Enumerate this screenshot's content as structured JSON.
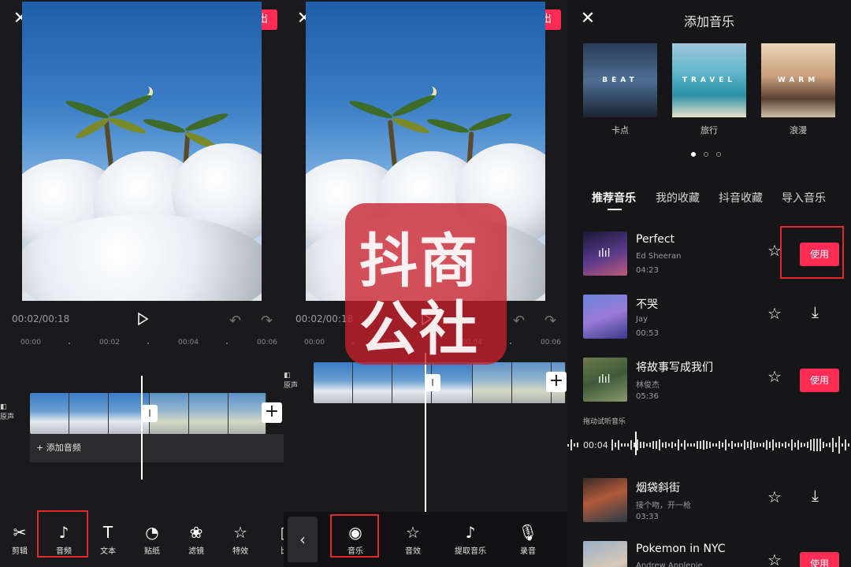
{
  "editor": {
    "export_label": "导出",
    "timecode": "00:02/00:18",
    "ruler_ticks": [
      "00:00",
      "00:02",
      "00:04",
      "00:06"
    ],
    "mute_label": "原声",
    "add_audio_label": "+ 添加音频"
  },
  "toolbar_main": [
    {
      "label": "剪辑",
      "icon": "scissors-icon",
      "glyph": "✂"
    },
    {
      "label": "音频",
      "icon": "music-note-icon",
      "glyph": "♪"
    },
    {
      "label": "文本",
      "icon": "text-icon",
      "glyph": "T"
    },
    {
      "label": "贴纸",
      "icon": "sticker-icon",
      "glyph": "◔"
    },
    {
      "label": "滤镜",
      "icon": "filter-icon",
      "glyph": "❀"
    },
    {
      "label": "特效",
      "icon": "effects-icon",
      "glyph": "☆"
    },
    {
      "label": "比",
      "icon": "ratio-icon",
      "glyph": "▯"
    }
  ],
  "toolbar_audio": [
    {
      "label": "音乐",
      "icon": "music-disc-icon",
      "glyph": "◉"
    },
    {
      "label": "音效",
      "icon": "sound-effect-icon",
      "glyph": "☆"
    },
    {
      "label": "提取音乐",
      "icon": "tiktok-icon",
      "glyph": "♪"
    },
    {
      "label": "录音",
      "icon": "microphone-icon",
      "glyph": "🎙"
    }
  ],
  "watermark": {
    "line1": "抖商",
    "line2": "公社"
  },
  "music_panel": {
    "title": "添加音乐",
    "categories": [
      {
        "word": "BEAT",
        "label": "卡点"
      },
      {
        "word": "TRAVEL",
        "label": "旅行"
      },
      {
        "word": "WARM",
        "label": "浪漫"
      }
    ],
    "tabs": [
      "推荐音乐",
      "我的收藏",
      "抖音收藏",
      "导入音乐"
    ],
    "use_label": "使用",
    "drag_hint": "拖动试听音乐",
    "preview_time": "00:04",
    "songs": [
      {
        "title": "Perfect",
        "artist": "Ed Sheeran",
        "duration": "04:23",
        "action": "use"
      },
      {
        "title": "不哭",
        "artist": "Jay",
        "duration": "00:53",
        "action": "download"
      },
      {
        "title": "将故事写成我们",
        "artist": "林俊杰",
        "duration": "05:36",
        "action": "use"
      },
      {
        "title": "烟袋斜街",
        "artist": "接个吻，开一枪",
        "duration": "03:33",
        "action": "download"
      },
      {
        "title": "Pokemon in NYC",
        "artist": "Andrew Applepie",
        "duration": "",
        "action": "use"
      }
    ]
  },
  "colors": {
    "accent": "#fe2c55",
    "highlight_box": "#e22a2a",
    "watermark": "#c8202c"
  }
}
